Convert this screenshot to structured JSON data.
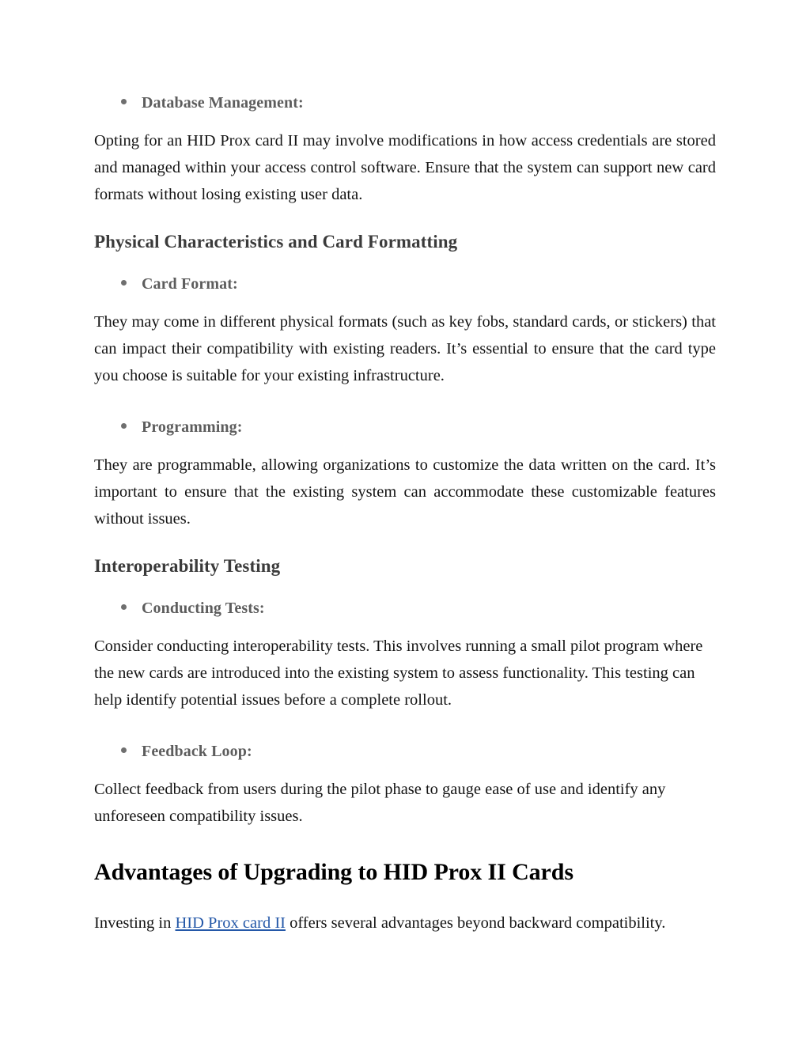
{
  "document": {
    "blocks": [
      {
        "type": "bullet",
        "label": "Database Management:"
      },
      {
        "type": "paragraph",
        "text": "Opting for an HID Prox card II may involve modifications in how access credentials are stored and managed within your access control software. Ensure that the system can support new card formats without losing existing user data."
      },
      {
        "type": "heading3",
        "text": "Physical Characteristics and Card Formatting"
      },
      {
        "type": "bullet",
        "label": "Card Format:"
      },
      {
        "type": "paragraph",
        "text": "They may come in different physical formats (such as key fobs, standard cards, or stickers) that can impact their compatibility with existing readers. It’s essential to ensure that the card type you choose is suitable for your existing infrastructure."
      },
      {
        "type": "bullet",
        "label": "Programming:"
      },
      {
        "type": "paragraph",
        "text": "They are programmable, allowing organizations to customize the data written on the card. It’s important to ensure that the existing system can accommodate these customizable features without issues."
      },
      {
        "type": "heading3",
        "text": "Interoperability Testing"
      },
      {
        "type": "bullet",
        "label": "Conducting Tests:"
      },
      {
        "type": "paragraph",
        "text": "Consider conducting interoperability tests. This involves running a small pilot program where the new cards are introduced into the existing system to assess functionality. This testing can help identify potential issues before a complete rollout."
      },
      {
        "type": "bullet",
        "label": "Feedback Loop:"
      },
      {
        "type": "paragraph",
        "text": "Collect feedback from users during the pilot phase to gauge ease of use and identify any unforeseen compatibility issues."
      },
      {
        "type": "heading2",
        "text": "Advantages of Upgrading to HID Prox II Cards"
      },
      {
        "type": "paragraph-with-link",
        "prefix": "Investing in ",
        "link_text": "HID Prox card II",
        "suffix": " offers several advantages beyond backward compatibility."
      }
    ],
    "sections": {
      "database_management": {
        "label": "Database Management:",
        "body": "Opting for an HID Prox card II may involve modifications in how access credentials are stored and managed within your access control software. Ensure that the system can support new card formats without losing existing user data."
      },
      "physical_characteristics": {
        "heading": "Physical Characteristics and Card Formatting",
        "card_format": {
          "label": "Card Format:",
          "body": "They may come in different physical formats (such as key fobs, standard cards, or stickers) that can impact their compatibility with existing readers. It’s essential to ensure that the card type you choose is suitable for your existing infrastructure."
        },
        "programming": {
          "label": "Programming:",
          "body": "They are programmable, allowing organizations to customize the data written on the card. It’s important to ensure that the existing system can accommodate these customizable features without issues."
        }
      },
      "interoperability_testing": {
        "heading": "Interoperability Testing",
        "conducting_tests": {
          "label": "Conducting Tests:",
          "body": "Consider conducting interoperability tests. This involves running a small pilot program where the new cards are introduced into the existing system to assess functionality. This testing can help identify potential issues before a complete rollout."
        },
        "feedback_loop": {
          "label": "Feedback Loop:",
          "body": "Collect feedback from users during the pilot phase to gauge ease of use and identify any unforeseen compatibility issues."
        }
      },
      "advantages": {
        "heading": "Advantages of Upgrading to HID Prox II Cards",
        "intro_prefix": "Investing in ",
        "intro_link": "HID Prox card II",
        "intro_suffix": " offers several advantages beyond backward compatibility."
      }
    },
    "colors": {
      "background": "#ffffff",
      "body_text": "#141414",
      "bullet_label": "#5d5d5d",
      "bullet_dot": "#6f6f6f",
      "heading3": "#3b3b3b",
      "heading2": "#000000",
      "link": "#2458a8"
    }
  }
}
